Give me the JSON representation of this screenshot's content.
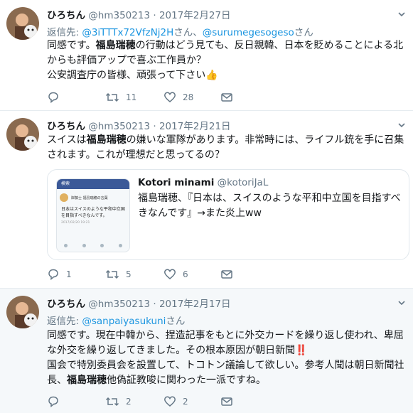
{
  "tweets": [
    {
      "name": "ひろちん",
      "handle": "@hm350213",
      "sep": "·",
      "date": "2017年2月27日",
      "reply_prefix": "返信先: ",
      "reply_user1": "@3iTTTx72VfzNj2H",
      "reply_mid": "さん、",
      "reply_user2": "@surumegesogeso",
      "reply_suffix": "さん",
      "text": [
        {
          "t": "同感です。"
        },
        {
          "t": "福島瑞穂",
          "b": true
        },
        {
          "t": "の行動はどう見ても、反日親韓、日本を貶めることによる北からも評価アップで喜ぶ工作員か？\n公安調査庁の皆様、頑張って下さい👍"
        }
      ],
      "reply_count": "",
      "retweet_count": "11",
      "like_count": "28"
    },
    {
      "name": "ひろちん",
      "handle": "@hm350213",
      "sep": "·",
      "date": "2017年2月21日",
      "text": [
        {
          "t": "スイスは"
        },
        {
          "t": "福島瑞穂",
          "b": true
        },
        {
          "t": "の嫌いな軍隊があります。非常時には、ライフル銃を手に召集されます。これが理想だと思ってるの？"
        }
      ],
      "quote": {
        "name": "Kotori minami",
        "handle": "@kotoriJaL",
        "text": "福島瑞穂、『日本は、スイスのような平和中立国を目指すべきなんです』→また炎上ww",
        "thumb_header": "検索",
        "thumb_author": "岸藤士 福島瑞穂の言葉",
        "thumb_text": "日本はスイスのような平和中立国を目指すべきなんです。",
        "thumb_time": "2017/02/20 19:21"
      },
      "reply_count": "1",
      "retweet_count": "5",
      "like_count": "6"
    },
    {
      "name": "ひろちん",
      "handle": "@hm350213",
      "sep": "·",
      "date": "2017年2月17日",
      "reply_prefix": "返信先: ",
      "reply_user1": "@sanpaiyasukuni",
      "reply_suffix": "さん",
      "text": [
        {
          "t": "同感です。現在中韓から、捏造記事をもとに外交カードを繰り返し使われ、卑屈な外交を繰り返してきました。その根本原因が朝日新聞‼️\n国会で特別委員会を設置して、トコトン議論して欲しい。参考人聞は朝日新聞社長、"
        },
        {
          "t": "福島瑞穂",
          "b": true
        },
        {
          "t": "他偽証教唆に関わった一派ですね。"
        }
      ],
      "reply_count": "",
      "retweet_count": "2",
      "like_count": "2"
    }
  ]
}
